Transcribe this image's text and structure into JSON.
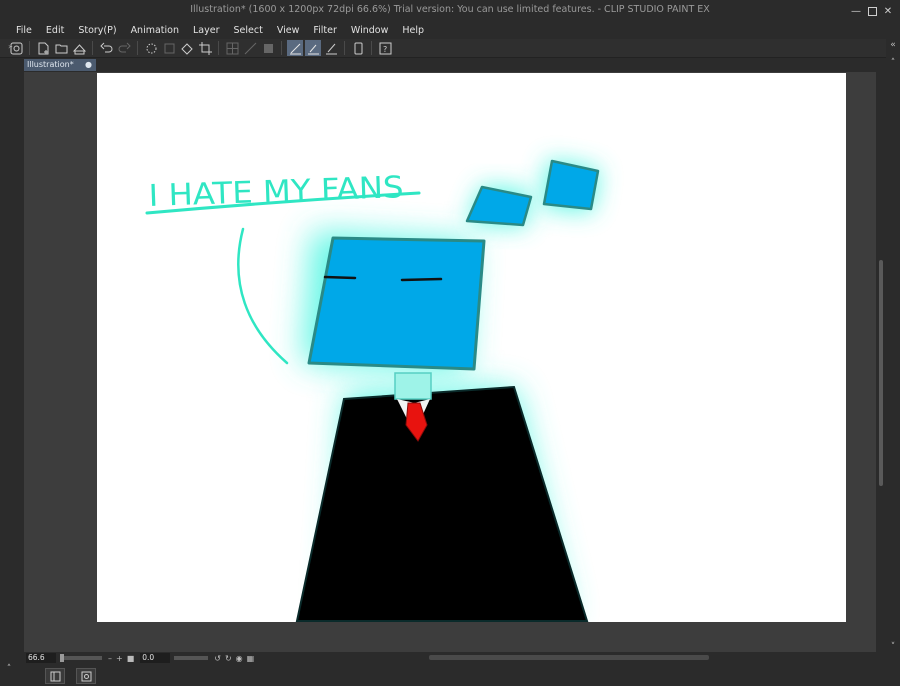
{
  "app": {
    "title": "Illustration* (1600 x 1200px 72dpi 66.6%)  Trial version: You can use limited features. - CLIP STUDIO PAINT EX"
  },
  "menu": [
    "File",
    "Edit",
    "Story(P)",
    "Animation",
    "Layer",
    "Select",
    "View",
    "Filter",
    "Window",
    "Help"
  ],
  "document_tab": {
    "label": "Illustration*",
    "close": "●"
  },
  "canvas": {
    "drawing_text": "I HATE MY FANS",
    "colors": {
      "glow": "#3ff5e0",
      "head": "#00a8e8",
      "suit": "#000000",
      "tie": "#e8130f",
      "text": "#2fe6c3"
    }
  },
  "status": {
    "zoom": "66.6",
    "angle": "0.0"
  },
  "icons": {
    "toolbar": [
      "clip-studio-icon",
      "new-icon",
      "open-icon",
      "save-icon",
      "undo-icon",
      "redo-icon",
      "loading-icon",
      "transform-icon",
      "fill-icon",
      "crop-icon",
      "grid-icon",
      "ruler-icon",
      "ruler-edit-icon",
      "snap-ruler-icon",
      "snap-special-ruler-icon",
      "snap-grid-icon",
      "smartphone-icon",
      "help-icon"
    ],
    "window": [
      "minimize-icon",
      "maximize-icon",
      "close-icon"
    ]
  }
}
